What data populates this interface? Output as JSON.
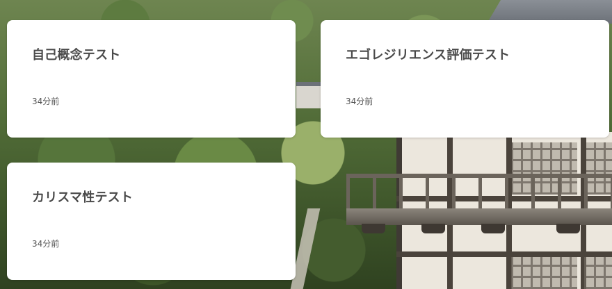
{
  "cards": [
    {
      "title": "自己概念テスト",
      "time": "34分前"
    },
    {
      "title": "エゴレジリエンス評価テスト",
      "time": "34分前"
    },
    {
      "title": "カリスマ性テスト",
      "time": "34分前"
    }
  ]
}
